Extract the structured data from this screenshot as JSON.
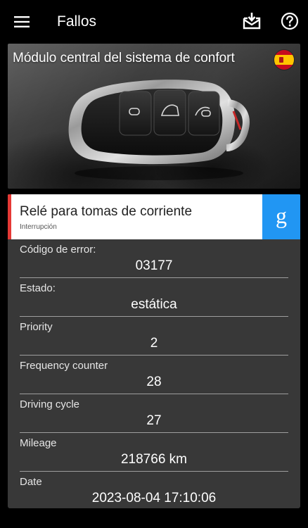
{
  "app_bar": {
    "title": "Fallos",
    "icons": {
      "menu": "menu-icon",
      "export": "inbox-download-icon",
      "help": "help-circle-icon"
    }
  },
  "module": {
    "title": "Módulo central del sistema de confort",
    "flag_icon": "spain-flag-icon",
    "image": "car-key-fob-illustration"
  },
  "fault": {
    "title": "Relé para tomas de corriente",
    "subtitle": "Interrupción",
    "search_icon": "google-g-icon",
    "accent_color": "#e53935",
    "search_color": "#2196f3"
  },
  "details": [
    {
      "label": "Código de error:",
      "value": "03177"
    },
    {
      "label": "Estado:",
      "value": "estática"
    },
    {
      "label": "Priority",
      "value": "2"
    },
    {
      "label": "Frequency counter",
      "value": "28"
    },
    {
      "label": "Driving cycle",
      "value": "27"
    },
    {
      "label": "Mileage",
      "value": "218766 km"
    },
    {
      "label": "Date",
      "value": "2023-08-04 17:10:06"
    }
  ]
}
